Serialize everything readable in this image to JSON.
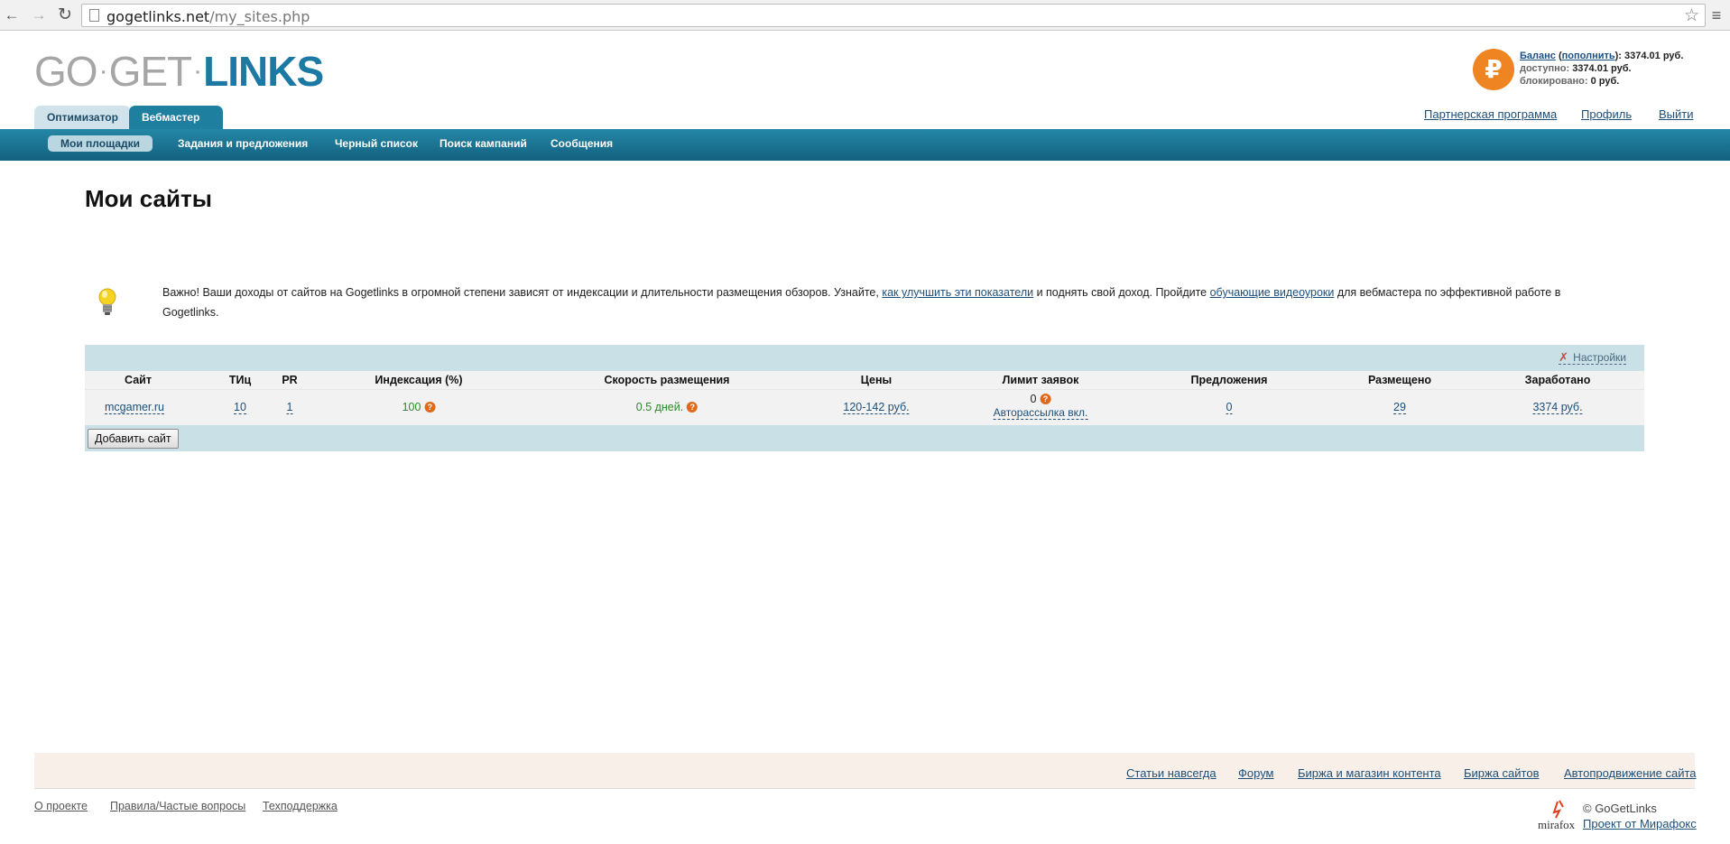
{
  "browser": {
    "url_host": "gogetlinks.net",
    "url_path": "/my_sites.php"
  },
  "logo": {
    "part1": "GO",
    "part2": "GET",
    "part3": "LINKS"
  },
  "balance": {
    "currency_icon": "₽",
    "balance_label": "Баланс",
    "topup_label": "пополнить",
    "balance_value": "3374.01 руб.",
    "available_label": "доступно:",
    "available_value": "3374.01 руб.",
    "blocked_label": "блокировано:",
    "blocked_value": "0 руб."
  },
  "role_tabs": {
    "optimizer": "Оптимизатор",
    "webmaster": "Вебмастер"
  },
  "top_links": {
    "partner": "Партнерская программа",
    "profile": "Профиль",
    "logout": "Выйти"
  },
  "nav": {
    "my_sites": "Мои площадки",
    "tasks": "Задания и предложения",
    "blacklist": "Черный список",
    "campaigns": "Поиск кампаний",
    "messages": "Сообщения"
  },
  "page_title": "Мои сайты",
  "notice": {
    "text1": "Важно! Ваши доходы от сайтов на Gogetlinks в огромной степени зависят от индексации и длительности размещения обзоров. Узнайте, ",
    "link1": "как улучшить эти показатели",
    "text2": " и поднять свой доход. Пройдите ",
    "link2": "обучающие видеоуроки",
    "text3": " для вебмастера по эффективной работе в Gogetlinks."
  },
  "table": {
    "settings_label": "Настройки",
    "headers": {
      "site": "Сайт",
      "tic": "ТИц",
      "pr": "PR",
      "indexing": "Индексация (%)",
      "speed": "Скорость размещения",
      "prices": "Цены",
      "limit": "Лимит заявок",
      "offers": "Предложения",
      "placed": "Размещено",
      "earned": "Заработано"
    },
    "rows": [
      {
        "site": "mcgamer.ru",
        "tic": "10",
        "pr": "1",
        "indexing": "100",
        "speed": "0.5 дней.",
        "prices": "120-142 руб.",
        "limit": "0",
        "autosend": "Авторассылка вкл.",
        "offers": "0",
        "placed": "29",
        "earned": "3374 руб."
      }
    ],
    "add_button": "Добавить сайт"
  },
  "footer": {
    "links": [
      "Статьи навсегда",
      "Форум",
      "Биржа и магазин контента",
      "Биржа сайтов",
      "Автопродвижение сайта"
    ],
    "bottom_links": [
      "О проекте",
      "Правила/Частые вопросы",
      "Техподдержка"
    ],
    "mirafox": "mirafox",
    "copyright": "© GoGetLinks",
    "project": "Проект от Мирафокс"
  },
  "colors": {
    "brand_blue": "#1c79a3",
    "nav_bar": "#1d7896",
    "table_band": "#c9e0e6",
    "ruble_orange": "#ee8422"
  }
}
